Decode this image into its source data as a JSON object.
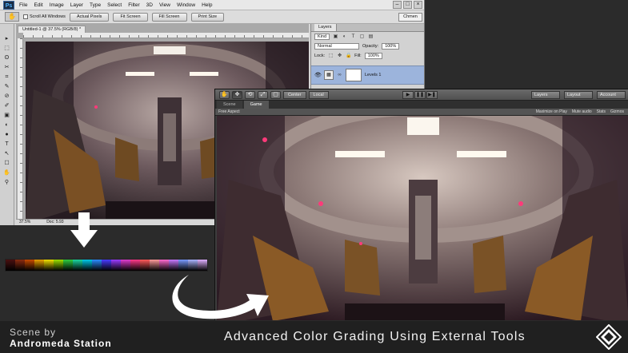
{
  "colors": {
    "ps_selected_layer": "#9cb4dc",
    "unity_bg": "#3d3d3d",
    "bottom_bar": "#202020"
  },
  "photoshop": {
    "logo": "Ps",
    "menu": [
      "File",
      "Edit",
      "Image",
      "Layer",
      "Type",
      "Select",
      "Filter",
      "3D",
      "View",
      "Window",
      "Help"
    ],
    "window_buttons": [
      "–",
      "□",
      "×"
    ],
    "options": {
      "scroll_all_windows": "Scroll All Windows",
      "buttons": [
        "Actual Pixels",
        "Fit Screen",
        "Fill Screen",
        "Print Size"
      ],
      "workspace": "Chmen"
    },
    "document": {
      "tab": "Untitled-1 @ 37.5% (RGB/8) *",
      "zoom": "37.5%",
      "doc_size": "Doc: 5.93"
    },
    "layers_panel": {
      "title": "Layers",
      "filter": "Kind",
      "blend_mode": "Normal",
      "opacity_label": "Opacity:",
      "opacity": "100%",
      "lock_label": "Lock:",
      "fill_label": "Fill:",
      "fill": "100%",
      "layer_name": "Levels 1"
    },
    "tools": [
      "▸",
      "⬚",
      "ʘ",
      "✂",
      "⌗",
      "✎",
      "⊘",
      "✐",
      "▣",
      "◐",
      "●",
      "T",
      "↖",
      "☐",
      "✋",
      "⚲"
    ]
  },
  "unity": {
    "tools": [
      "✋",
      "✥",
      "⟲",
      "⤢",
      "▢"
    ],
    "pivot": "Center",
    "space": "Local",
    "play_controls": [
      "▶",
      "❚❚",
      "▶❚"
    ],
    "layers": "Layers",
    "layout": "Layout",
    "account": "Account",
    "tabs": [
      "Scene",
      "Game"
    ],
    "aspect": "Free Aspect",
    "game_options": [
      "Maximize on Play",
      "Mute audio",
      "Stats",
      "Gizmos"
    ]
  },
  "lut_colors": [
    "#4a1010",
    "#8a2b10",
    "#c64a00",
    "#e8a000",
    "#f0e000",
    "#9be000",
    "#2ecc40",
    "#1bd6a0",
    "#00c8e8",
    "#2a8cff",
    "#4a3cff",
    "#9b3cff",
    "#e03cd0",
    "#ff3a8a",
    "#ff5a5a",
    "#ff9a9a",
    "#ff6ad0",
    "#c87aff",
    "#7a9aff",
    "#aab4ff",
    "#e0b0ff"
  ],
  "footer": {
    "credit_label": "Scene by",
    "credit_name": "Andromeda Station",
    "title": "Advanced Color Grading Using External Tools"
  }
}
